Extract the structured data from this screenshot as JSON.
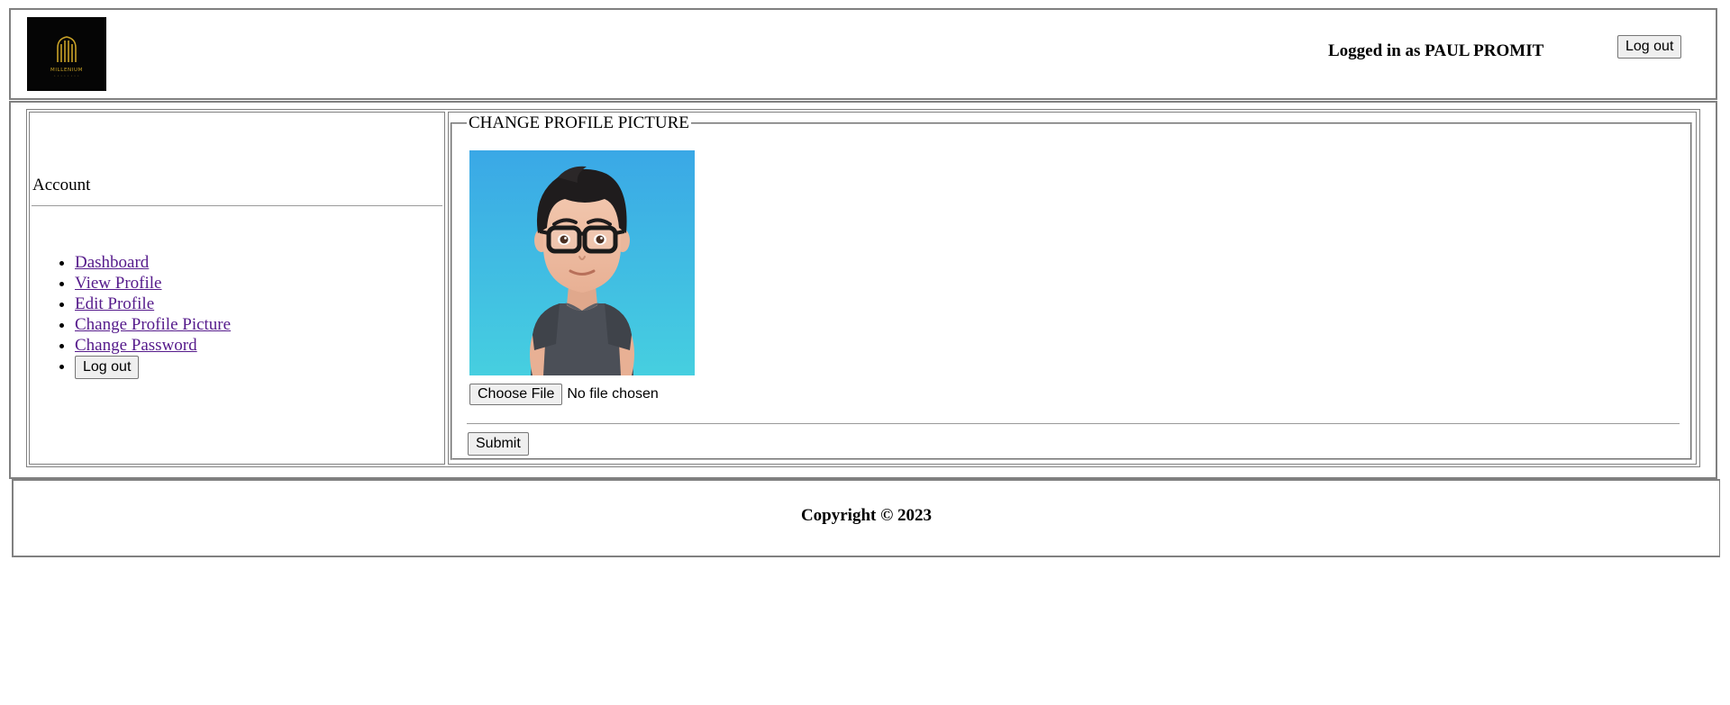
{
  "header": {
    "logo_alt": "MILLENIUM",
    "logo_text": "MILLENIUM",
    "logged_in_text": "Logged in as PAUL PROMIT",
    "logout_label": "Log out"
  },
  "sidebar": {
    "title": "Account",
    "items": [
      {
        "label": "Dashboard"
      },
      {
        "label": "View Profile"
      },
      {
        "label": "Edit Profile"
      },
      {
        "label": "Change Profile Picture"
      },
      {
        "label": "Change Password"
      }
    ],
    "logout_label": "Log out"
  },
  "content": {
    "legend": "CHANGE PROFILE PICTURE",
    "choose_file_label": "Choose File",
    "file_status": "No file chosen",
    "submit_label": "Submit"
  },
  "footer": {
    "copyright": "Copyright © 2023"
  },
  "colors": {
    "link": "#551a8b",
    "border": "#808080",
    "logo_bg": "#050505",
    "logo_gold": "#c9a227",
    "avatar_bg_top": "#3aa8e6",
    "avatar_bg_bottom": "#46cfe0"
  }
}
